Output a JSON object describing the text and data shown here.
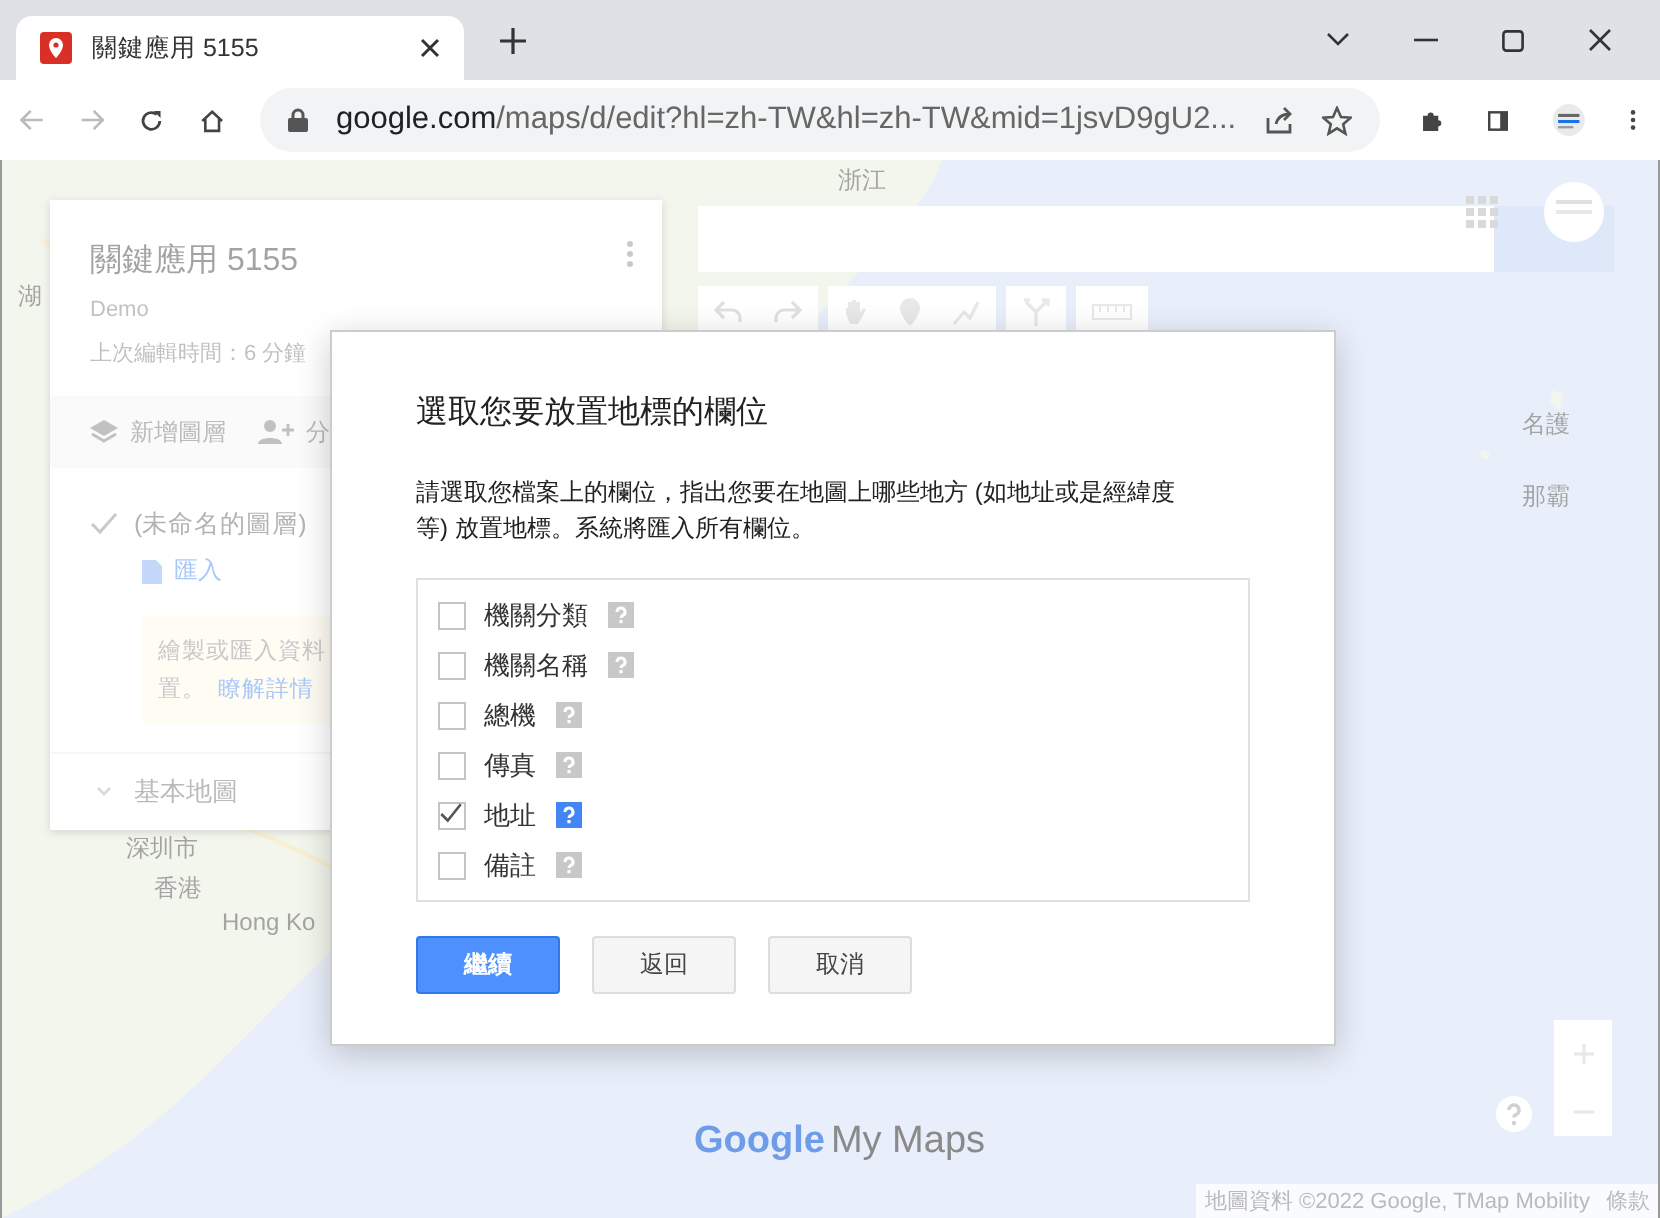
{
  "browser": {
    "tab_title": "關鍵應用 5155",
    "url_host": "google.com",
    "url_path": "/maps/d/edit?hl=zh-TW&hl=zh-TW&mid=1jsvD9gU2..."
  },
  "map_labels": [
    {
      "text": "浙江"
    },
    {
      "text": "湖"
    },
    {
      "text": "名護"
    },
    {
      "text": "那霸"
    },
    {
      "text": "深圳市"
    },
    {
      "text": "香港"
    },
    {
      "text": "Hong Ko"
    }
  ],
  "panel": {
    "title": "關鍵應用 5155",
    "subtitle": "Demo",
    "last_edited": "上次編輯時間：6 分鐘",
    "add_layer": "新增圖層",
    "share": "分",
    "layer": {
      "name": "(未命名的圖層)",
      "checked": true
    },
    "import": "匯入",
    "tip": [
      "繪製或匯入資料",
      "置。"
    ],
    "tip_link": "瞭解詳情",
    "base_map": "基本地圖"
  },
  "branding": {
    "google": "Google",
    "product": "My Maps"
  },
  "attribution": "地圖資料 ©2022 Google, TMap Mobility",
  "terms": "條款",
  "dialog": {
    "title": "選取您要放置地標的欄位",
    "description": "請選取您檔案上的欄位，指出您要在地圖上哪些地方 (如地址或是經緯度等) 放置地標。系統將匯入所有欄位。",
    "fields": [
      {
        "label": "機關分類",
        "checked": false
      },
      {
        "label": "機關名稱",
        "checked": false
      },
      {
        "label": "總機",
        "checked": false
      },
      {
        "label": "傳真",
        "checked": false
      },
      {
        "label": "地址",
        "checked": true
      },
      {
        "label": "備註",
        "checked": false
      }
    ],
    "buttons": [
      {
        "label": "繼續",
        "kind": "primary"
      },
      {
        "label": "返回",
        "kind": "secondary"
      },
      {
        "label": "取消",
        "kind": "secondary"
      }
    ]
  }
}
